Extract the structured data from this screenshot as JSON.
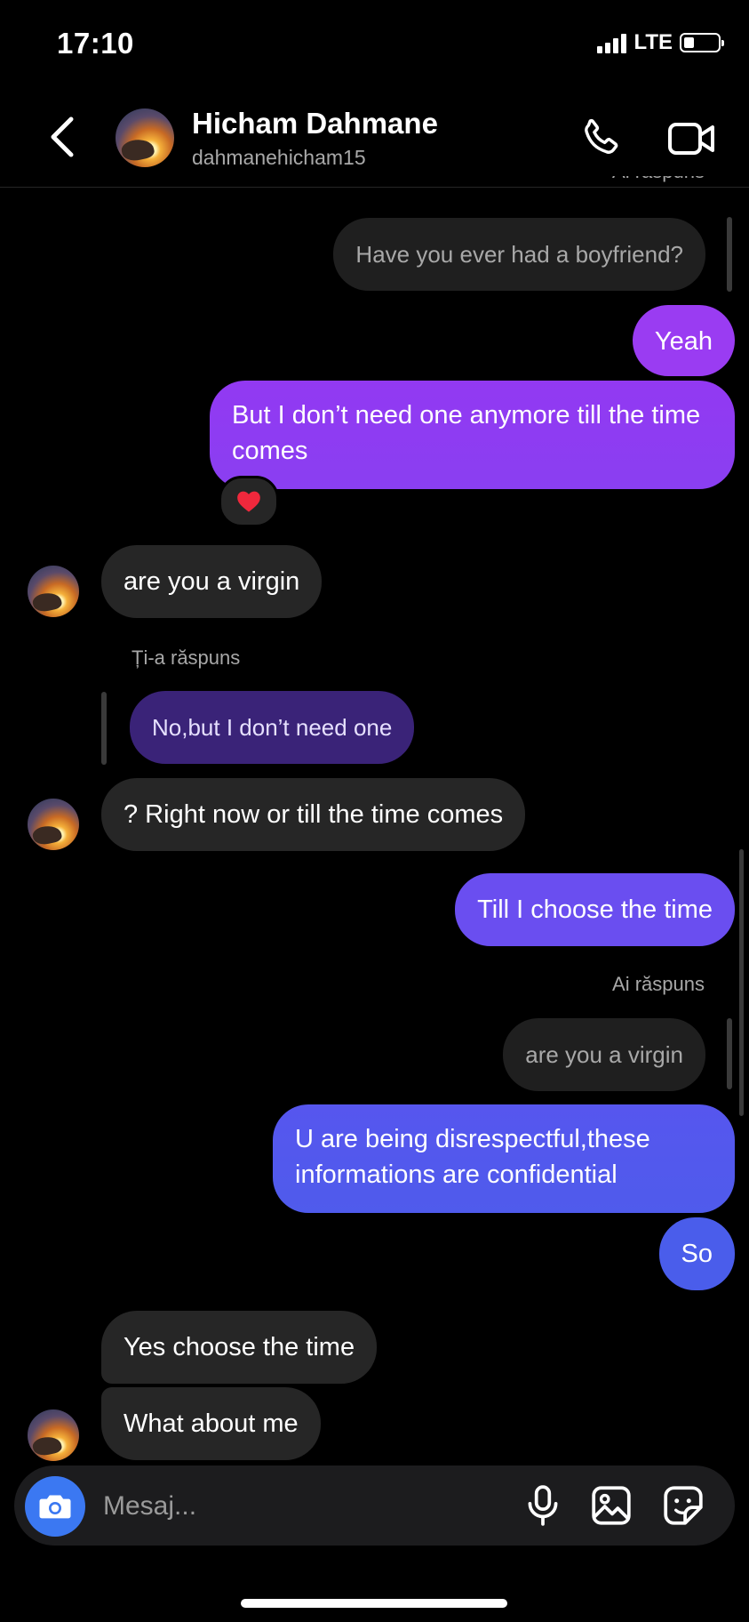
{
  "status_bar": {
    "time": "17:10",
    "network": "LTE"
  },
  "header": {
    "contact_name": "Hicham Dahmane",
    "username": "dahmanehicham15",
    "top_cut_label": "Ai răspuns"
  },
  "messages": [
    {
      "from": "me",
      "kind": "quoted-reply",
      "text": "Have you ever had a boyfriend?"
    },
    {
      "from": "me",
      "text": "Yeah"
    },
    {
      "from": "me",
      "text": "But I don’t need one anymore till the time comes",
      "reaction": "red-heart-icon"
    },
    {
      "from": "contact",
      "text": "are you a virgin"
    },
    {
      "from": "contact",
      "kind": "reply-label",
      "text": "Ți-a răspuns"
    },
    {
      "from": "contact",
      "kind": "quoted-reply",
      "text": "No,but I don’t need one"
    },
    {
      "from": "contact",
      "text": "?  Right now or till the time comes"
    },
    {
      "from": "me",
      "text": "Till I choose the time"
    },
    {
      "from": "me",
      "kind": "reply-label",
      "text": "Ai răspuns"
    },
    {
      "from": "me",
      "kind": "quoted-reply",
      "text": "are you a virgin"
    },
    {
      "from": "me",
      "text": "U are being disrespectful,these informations are confidential"
    },
    {
      "from": "me",
      "text": "So"
    },
    {
      "from": "contact",
      "text": "Yes choose the time"
    },
    {
      "from": "contact",
      "text": "What about me"
    }
  ],
  "composer": {
    "placeholder": "Mesaj..."
  },
  "colors": {
    "background": "#000000",
    "incoming_bubble": "#262626",
    "outgoing_top": "#9b3df0",
    "outgoing_bottom": "#4a58ec",
    "camera_button": "#3b78f2"
  },
  "icons": [
    "back-arrow-icon",
    "phone-icon",
    "video-camera-icon",
    "camera-icon",
    "microphone-icon",
    "gallery-icon",
    "sticker-icon",
    "red-heart-icon"
  ]
}
